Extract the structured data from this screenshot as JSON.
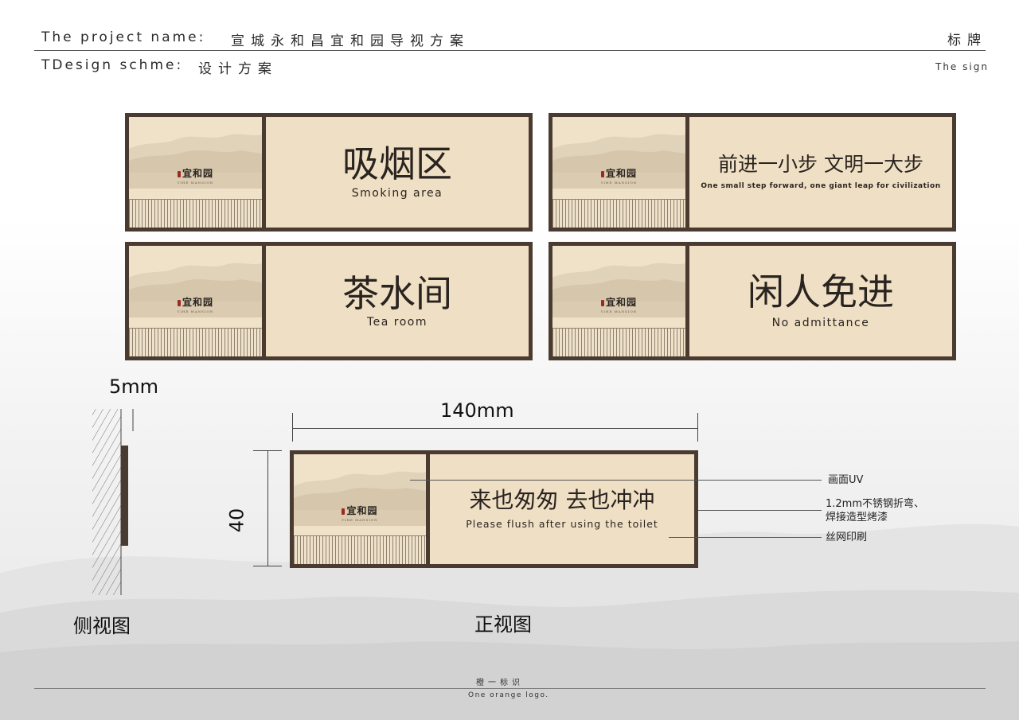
{
  "header": {
    "project_label": "The project name:",
    "project_name": "宣城永和昌宜和园导视方案",
    "design_label": "TDesign schme:",
    "design_value": "设计方案",
    "category_zh": "标牌",
    "category_en": "The sign"
  },
  "logo": {
    "name": "宜和园",
    "subtitle": "YIHE MANSION"
  },
  "signs": [
    {
      "title_zh": "吸烟区",
      "title_en": "Smoking area"
    },
    {
      "title_zh": "前进一小步 文明一大步",
      "title_en": "One small step forward, one giant leap for civilization"
    },
    {
      "title_zh": "茶水间",
      "title_en": "Tea room"
    },
    {
      "title_zh": "闲人免进",
      "title_en": "No admittance"
    }
  ],
  "front_sign": {
    "title_zh": "来也匆匆 去也冲冲",
    "title_en": "Please flush after using the toilet"
  },
  "dimensions": {
    "thickness": "5mm",
    "width": "140mm",
    "height": "40"
  },
  "callouts": {
    "uv": "画面UV",
    "steel_line1": "1.2mm不锈钢折弯、",
    "steel_line2": "焊接造型烤漆",
    "print": "丝网印刷"
  },
  "views": {
    "side": "侧视图",
    "front": "正视图"
  },
  "footer": {
    "brand_zh": "橙一标识",
    "brand_en": "One orange logo."
  },
  "colors": {
    "frame": "#4a3b30",
    "panel": "#efdfc4",
    "text": "#2a2420"
  }
}
